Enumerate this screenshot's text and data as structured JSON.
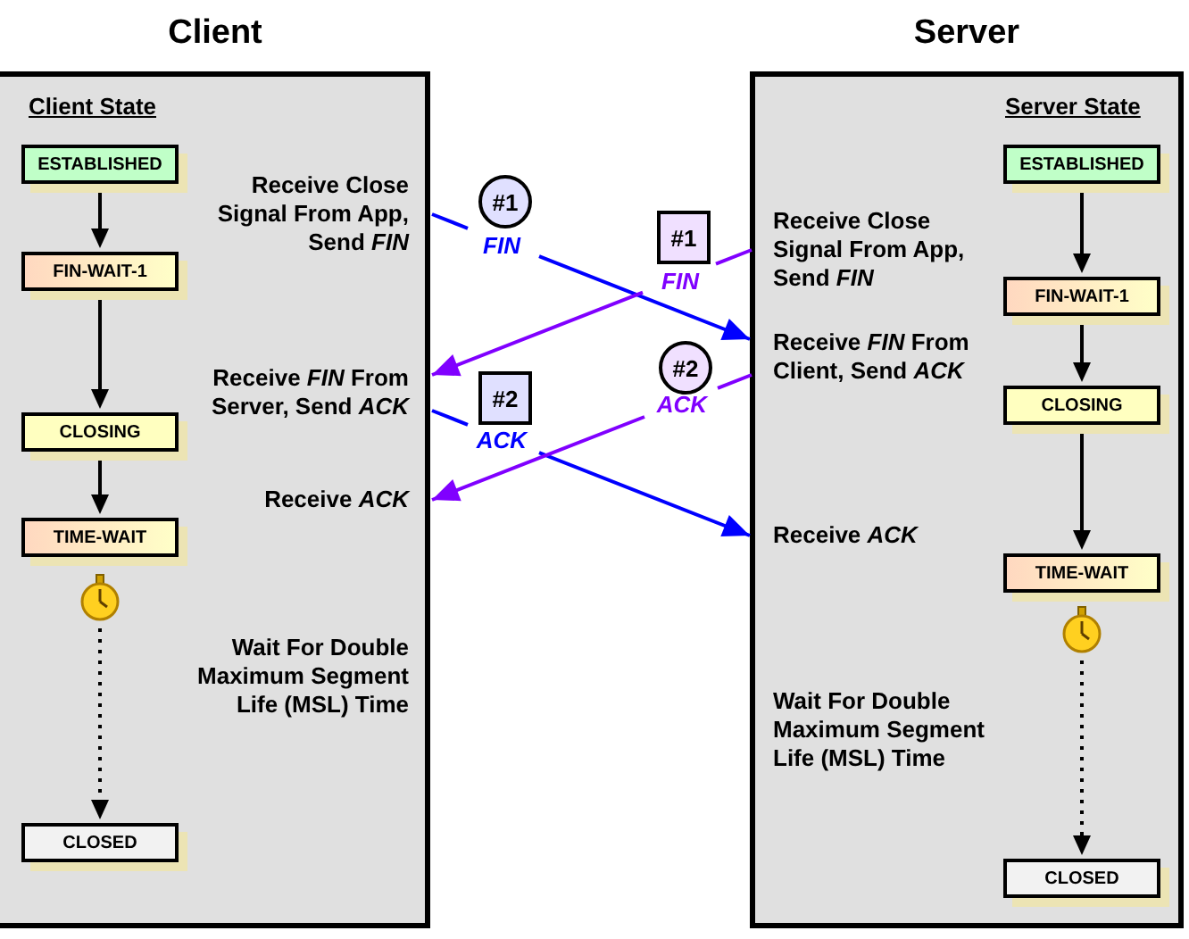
{
  "columns": [
    {
      "kind": "client",
      "title": "Client",
      "state_heading": "Client State",
      "states": [
        {
          "label": "ESTABLISHED",
          "kind": "established"
        },
        {
          "label": "FIN-WAIT-1",
          "kind": "waiting"
        },
        {
          "label": "CLOSING",
          "kind": "closing"
        },
        {
          "label": "TIME-WAIT",
          "kind": "time_wait"
        },
        {
          "label": "CLOSED",
          "kind": "closed"
        }
      ],
      "events": [
        {
          "lines": [
            "Receive Close",
            "Signal From App,",
            "Send *FIN*"
          ]
        },
        {
          "lines": [
            "Receive *FIN* From",
            "Server, Send *ACK*"
          ]
        },
        {
          "lines": [
            "Receive *ACK*"
          ]
        },
        {
          "lines": [
            "Wait For Double",
            "Maximum Segment",
            "Life (MSL) Time"
          ]
        }
      ]
    },
    {
      "kind": "server",
      "title": "Server",
      "state_heading": "Server State",
      "states": [
        {
          "label": "ESTABLISHED",
          "kind": "established"
        },
        {
          "label": "FIN-WAIT-1",
          "kind": "waiting"
        },
        {
          "label": "CLOSING",
          "kind": "closing"
        },
        {
          "label": "TIME-WAIT",
          "kind": "time_wait"
        },
        {
          "label": "CLOSED",
          "kind": "closed"
        }
      ],
      "events": [
        {
          "lines": [
            "Receive Close",
            "Signal From App,",
            "Send *FIN*"
          ]
        },
        {
          "lines": [
            "Receive *FIN* From",
            "Client, Send *ACK*"
          ]
        },
        {
          "lines": [
            "Receive *ACK*"
          ]
        },
        {
          "lines": [
            "Wait For Double",
            "Maximum Segment",
            "Life (MSL) Time"
          ]
        }
      ]
    }
  ],
  "messages": [
    {
      "kind": "client",
      "badge": {
        "kind": "circle",
        "number": "#1"
      },
      "label": "FIN"
    },
    {
      "kind": "server",
      "badge": {
        "kind": "square",
        "number": "#1"
      },
      "label": "FIN"
    },
    {
      "kind": "client",
      "badge": {
        "kind": "square",
        "number": "#2"
      },
      "label": "ACK"
    },
    {
      "kind": "server",
      "badge": {
        "kind": "circle",
        "number": "#2"
      },
      "label": "ACK"
    }
  ]
}
